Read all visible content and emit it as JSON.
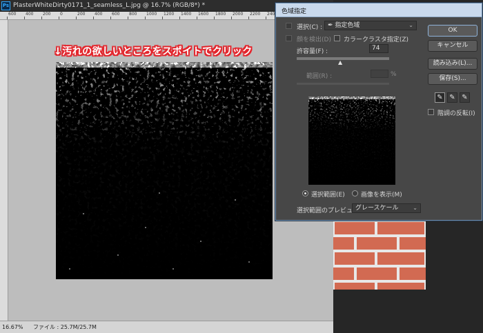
{
  "document": {
    "title": "PlasterWhiteDirty0171_1_seamless_L.jpg @ 16.7% (RGB/8*) *",
    "ps_badge": "Ps",
    "ruler_ticks": [
      "600",
      "400",
      "200",
      "0",
      "200",
      "400",
      "600",
      "800",
      "1000",
      "1200",
      "1400",
      "1600",
      "1800",
      "2000",
      "2200",
      "2400",
      "2600",
      "2800",
      "30"
    ],
    "status": {
      "zoom": "16.67%",
      "file_label": "ファイル : 25.7M/25.7M"
    }
  },
  "annotation": {
    "text": "↓汚れの欲しいところをスポイトでクリック",
    "color": "#e3262d"
  },
  "dialog": {
    "title": "色域指定",
    "select_label": "選択(C) :",
    "select_value": "指定色域",
    "detect_faces_label": "顔を検出(D)",
    "localized_clusters_label": "カラークラスタ指定(Z)",
    "fuzziness_label": "許容量(F) :",
    "fuzziness_value": "74",
    "range_label": "範囲(R) :",
    "range_unit": "%",
    "radio_selection": "選択範囲(E)",
    "radio_image": "画像を表示(M)",
    "preview_label": "選択範囲のプレビュー :",
    "preview_value": "グレースケール",
    "buttons": {
      "ok": "OK",
      "cancel": "キャンセル",
      "load": "読み込み(L)...",
      "save": "保存(S)..."
    },
    "invert_label": "階調の反転(I)",
    "eyedroppers": [
      "eyedropper-icon",
      "eyedropper-plus-icon",
      "eyedropper-minus-icon"
    ]
  },
  "colors": {
    "accent_dialog_title": "#c9d9ec",
    "canvas_bg": "#bdbdbd",
    "brick": "#d26a52"
  }
}
